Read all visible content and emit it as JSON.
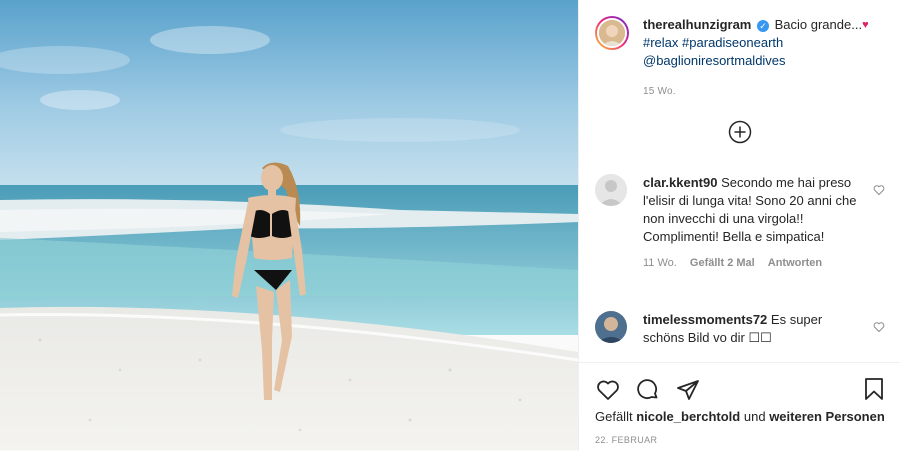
{
  "post": {
    "username": "therealhunzigram",
    "verified_mark": "✓",
    "caption_text": "Bacio grande...",
    "caption_heart": "♥",
    "hashtag1": "#relax",
    "hashtag2": "#paradiseonearth",
    "mention": "@baglioniresortmaldives",
    "time": "15 Wo."
  },
  "comments": [
    {
      "username": "clar.kkent90",
      "text": "Secondo me hai preso l'elisir di lunga vita! Sono 20 anni che non invecchi di una virgola!! Complimenti! Bella e simpatica!",
      "time": "11 Wo.",
      "likes": "Gefällt 2 Mal",
      "reply": "Antworten"
    },
    {
      "username": "timelessmoments72",
      "text": "Es super schöns Bild vo dir ☐☐"
    }
  ],
  "footer": {
    "liked_prefix": "Gefällt",
    "liked_user": "nicole_berchtold",
    "liked_mid": "und",
    "liked_others": "weiteren Personen",
    "date": "22. Februar"
  },
  "icons": {
    "load_more": "plus-circle-icon",
    "like": "heart-icon",
    "comment": "comment-icon",
    "share": "share-icon",
    "save": "bookmark-icon"
  },
  "colors": {
    "link": "#00376b",
    "verified": "#3897f0",
    "muted": "#8e8e8e"
  }
}
